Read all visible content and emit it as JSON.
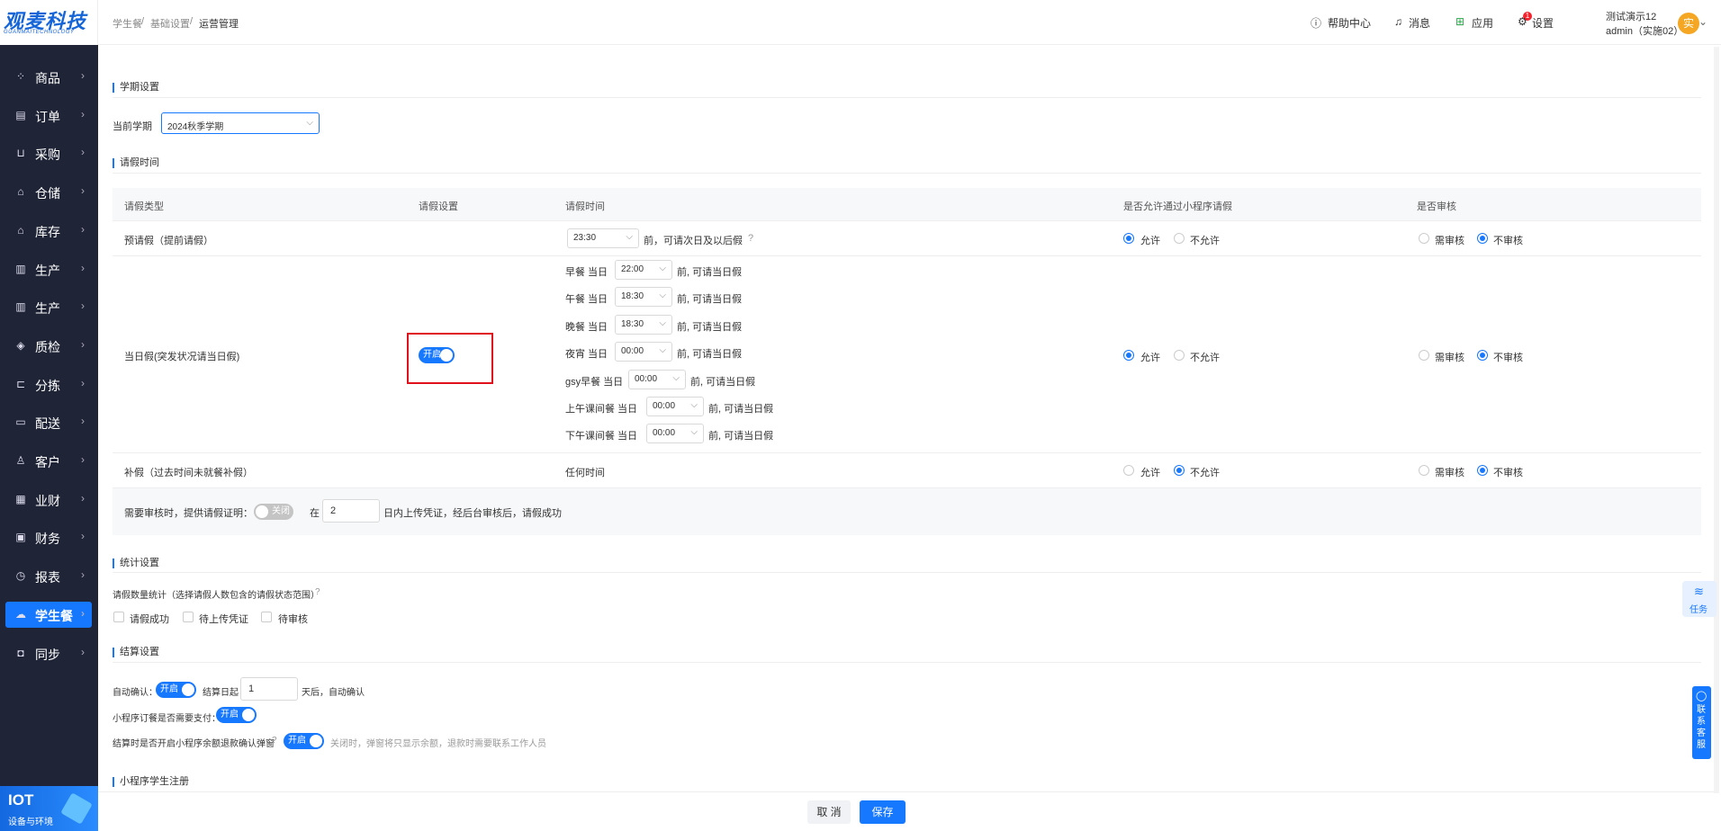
{
  "brand": {
    "name": "观麦科技",
    "sub": "GUANMAITECHNOLOGY"
  },
  "sidebar": {
    "items": [
      {
        "label": "商品",
        "icon": "grid-icon",
        "glyph": "⁘"
      },
      {
        "label": "订单",
        "icon": "order-icon",
        "glyph": "▤"
      },
      {
        "label": "采购",
        "icon": "basket-icon",
        "glyph": "⊔"
      },
      {
        "label": "仓储",
        "icon": "warehouse-icon",
        "glyph": "⌂"
      },
      {
        "label": "库存",
        "icon": "inventory-icon",
        "glyph": "⌂"
      },
      {
        "label": "生产",
        "icon": "factory-icon",
        "glyph": "▥"
      },
      {
        "label": "生产",
        "icon": "factory-icon",
        "glyph": "▥"
      },
      {
        "label": "质检",
        "icon": "shield-icon",
        "glyph": "◈"
      },
      {
        "label": "分拣",
        "icon": "sort-icon",
        "glyph": "⊏"
      },
      {
        "label": "配送",
        "icon": "truck-icon",
        "glyph": "▭"
      },
      {
        "label": "客户",
        "icon": "user-icon",
        "glyph": "♙"
      },
      {
        "label": "业财",
        "icon": "chart-icon",
        "glyph": "▦"
      },
      {
        "label": "财务",
        "icon": "finance-icon",
        "glyph": "▣"
      },
      {
        "label": "报表",
        "icon": "clock-icon",
        "glyph": "◷"
      },
      {
        "label": "学生餐",
        "icon": "cloud-icon",
        "glyph": "☁"
      },
      {
        "label": "同步",
        "icon": "sync-icon",
        "glyph": "◘"
      }
    ],
    "iot": {
      "title": "IOT",
      "sub": "设备与环境"
    }
  },
  "header": {
    "breadcrumb": [
      "学生餐",
      "基础设置",
      "运营管理"
    ],
    "help": "帮助中心",
    "messages": "消息",
    "messages_badge": "1",
    "apps": "应用",
    "settings": "设置",
    "avatar_char": "实",
    "user_name": "测试演示12",
    "user_account": "admin（实施02）"
  },
  "semester": {
    "section": "学期设置",
    "label": "当前学期",
    "value": "2024秋季学期"
  },
  "leave": {
    "section": "请假时间",
    "columns": [
      "请假类型",
      "请假设置",
      "请假时间",
      "是否允许通过小程序请假",
      "是否审核"
    ],
    "advance": {
      "type": "预请假（提前请假）",
      "time": "23:30",
      "suffix": "前，可请次日及以后假",
      "allow": "允许",
      "deny": "不允许",
      "review": "需审核",
      "no_review": "不审核"
    },
    "sameday": {
      "type": "当日假(突发状况请当日假)",
      "switch_label": "开启",
      "meals": [
        {
          "name": "早餐 当日",
          "time": "22:00"
        },
        {
          "name": "午餐 当日",
          "time": "18:30"
        },
        {
          "name": "晚餐 当日",
          "time": "18:30"
        },
        {
          "name": "夜宵 当日",
          "time": "00:00"
        },
        {
          "name": "gsy早餐 当日",
          "time": "00:00"
        },
        {
          "name": "上午课间餐 当日",
          "time": "00:00"
        },
        {
          "name": "下午课间餐 当日",
          "time": "00:00"
        }
      ],
      "suffix": "前, 可请当日假",
      "allow": "允许",
      "deny": "不允许",
      "review": "需审核",
      "no_review": "不审核"
    },
    "makeup": {
      "type": "补假（过去时间未就餐补假）",
      "time": "任何时间",
      "allow": "允许",
      "deny": "不允许",
      "review": "需审核",
      "no_review": "不审核"
    },
    "proof": {
      "label": "需要审核时，提供请假证明：",
      "switch_label": "关闭",
      "pre": "在",
      "days": "2",
      "post": "日内上传凭证，经后台审核后，请假成功"
    }
  },
  "stats": {
    "section": "统计设置",
    "label": "请假数量统计（选择请假人数包含的请假状态范围）",
    "options": [
      "请假成功",
      "待上传凭证",
      "待审核"
    ]
  },
  "settle": {
    "section": "结算设置",
    "auto_label": "自动确认：",
    "auto_switch": "开启",
    "day_pre": "结算日起",
    "day_value": "1",
    "day_post": "天后，自动确认",
    "pay_label": "小程序订餐是否需要支付：",
    "pay_switch": "开启",
    "popup_label": "结算时是否开启小程序余额退款确认弹窗",
    "popup_switch": "开启",
    "popup_note": "关闭时，弹窗将只显示余额，退款时需要联系工作人员"
  },
  "register": {
    "section": "小程序学生注册"
  },
  "float": {
    "task": "任务",
    "contact": "联系客服"
  },
  "footer": {
    "cancel": "取 消",
    "save": "保存"
  },
  "colors": {
    "primary": "#1677ff",
    "sidebar": "#1f2436",
    "highlight": "#e0101c"
  }
}
